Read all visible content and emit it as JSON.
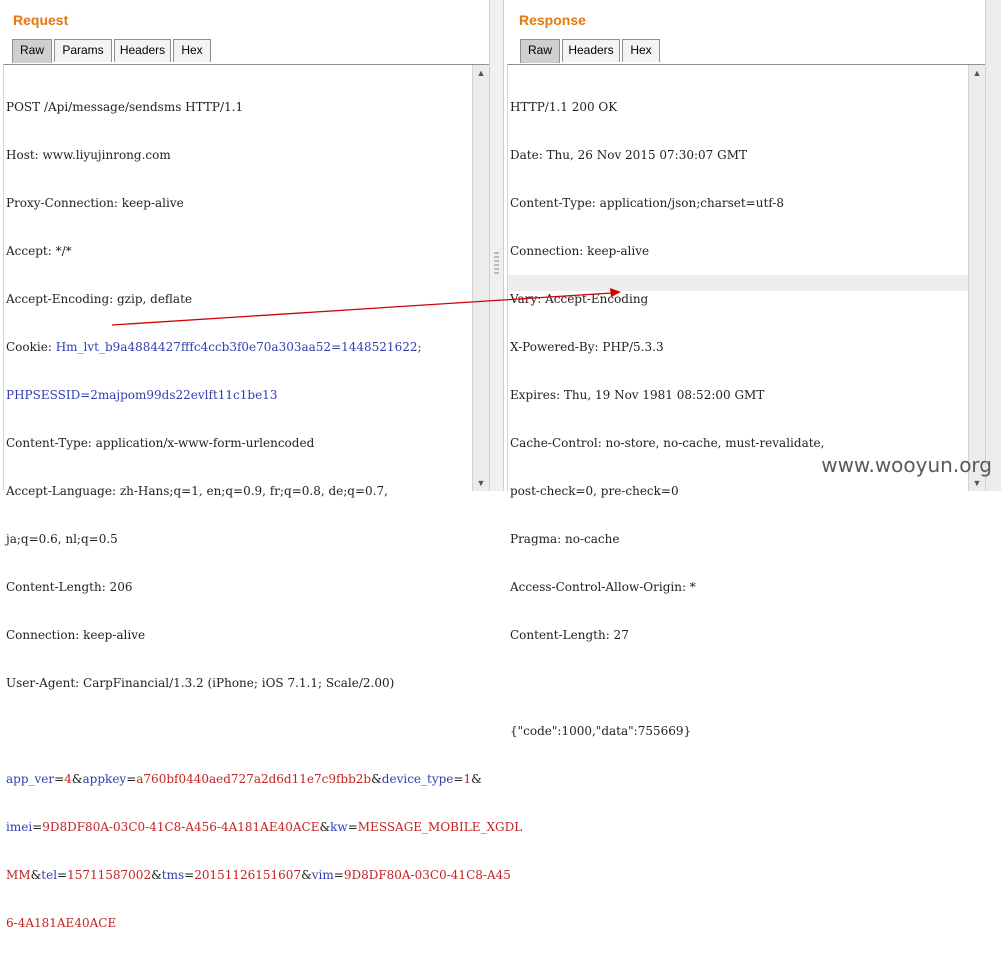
{
  "request": {
    "title": "Request",
    "tabs": [
      {
        "label": "Raw",
        "active": true
      },
      {
        "label": "Params",
        "active": false
      },
      {
        "label": "Headers",
        "active": false
      },
      {
        "label": "Hex",
        "active": false
      }
    ],
    "lines": [
      "POST /Api/message/sendsms HTTP/1.1",
      "Host: www.liyujinrong.com",
      "Proxy-Connection: keep-alive",
      "Accept: */*",
      "Accept-Encoding: gzip, deflate",
      "Cookie: ",
      "Hm_lvt_b9a4884427fffc4ccb3f0e70a303aa52=1448521622;",
      "PHPSESSID=2majpom99ds22evlft11c1be13",
      "Content-Type: application/x-www-form-urlencoded",
      "Accept-Language: zh-Hans;q=1, en;q=0.9, fr;q=0.8, de;q=0.7,",
      "ja;q=0.6, nl;q=0.5",
      "Content-Length: 206",
      "Connection: keep-alive",
      "User-Agent: CarpFinancial/1.3.2 (iPhone; iOS 7.1.1; Scale/2.00)"
    ],
    "body_parts": {
      "l1_a": "app_ver",
      "l1_b": "=",
      "l1_c": "4",
      "l1_d": "&",
      "l1_e": "appkey",
      "l1_f": "=",
      "l1_g": "a760bf0440aed727a2d6d11e7c9fbb2b",
      "l1_h": "&",
      "l1_i": "device_type",
      "l1_j": "=",
      "l1_k": "1",
      "l1_l": "&",
      "l2_a": "imei",
      "l2_b": "=",
      "l2_c": "9D8DF80A-03C0-41C8-A456-4A181AE40ACE",
      "l2_d": "&",
      "l2_e": "kw",
      "l2_f": "=",
      "l2_g": "MESSAGE_MOBILE_XGDL",
      "l3_a": "MM",
      "l3_b": "&",
      "l3_c": "tel",
      "l3_d": "=",
      "l3_e": "15711587002",
      "l3_f": "&",
      "l3_g": "tms",
      "l3_h": "=",
      "l3_i": "20151126151607",
      "l3_j": "&",
      "l3_k": "vim",
      "l3_l": "=",
      "l3_m": "9D8DF80A-03C0-41C8-A45",
      "l4_a": "6-4A181AE40ACE"
    }
  },
  "response": {
    "title": "Response",
    "tabs": [
      {
        "label": "Raw",
        "active": true
      },
      {
        "label": "Headers",
        "active": false
      },
      {
        "label": "Hex",
        "active": false
      }
    ],
    "lines": [
      "HTTP/1.1 200 OK",
      "Date: Thu, 26 Nov 2015 07:30:07 GMT",
      "Content-Type: application/json;charset=utf-8",
      "Connection: keep-alive",
      "Vary: Accept-Encoding",
      "X-Powered-By: PHP/5.3.3",
      "Expires: Thu, 19 Nov 1981 08:52:00 GMT",
      "Cache-Control: no-store, no-cache, must-revalidate,",
      "post-check=0, pre-check=0",
      "Pragma: no-cache",
      "Access-Control-Allow-Origin: *",
      "Content-Length: 27",
      "",
      "{\"code\":1000,\"data\":755669}"
    ]
  },
  "watermark": "www.wooyun.org",
  "colors": {
    "title": "#e8760c",
    "key": "#2f3fb0",
    "value": "#c02424",
    "arrow": "#d40000"
  }
}
